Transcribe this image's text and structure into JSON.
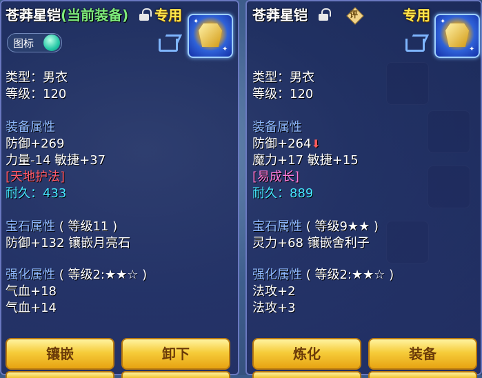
{
  "left": {
    "title": "苍莽星铠",
    "equipped_tag": "(当前装备)",
    "special_label": "专用",
    "icon_toggle_label": "图标",
    "type": "类型：男衣",
    "level": "等级：120",
    "section_equip": "装备属性",
    "attr1": "防御+269",
    "attr2": "力量-14 敏捷+37",
    "skill": "[天地护法]",
    "durability": "耐久：433",
    "gem_heading": "宝石属性",
    "gem_level": "( 等级11 )",
    "gem_attr": "防御+132 镶嵌月亮石",
    "enhance_heading": "强化属性",
    "enhance_level": "( 等级2:★★☆ )",
    "enhance1": "气血+18",
    "enhance2": "气血+14",
    "btn1": "镶嵌",
    "btn2": "卸下"
  },
  "right": {
    "title": "苍莽星铠",
    "special_label": "专用",
    "rate_label": "评",
    "type": "类型：男衣",
    "level": "等级：120",
    "section_equip": "装备属性",
    "attr1": "防御+264",
    "attr2": "魔力+17 敏捷+15",
    "skill": "[易成长]",
    "durability": "耐久：889",
    "gem_heading": "宝石属性",
    "gem_level": "( 等级9★★ )",
    "gem_attr": "灵力+68 镶嵌舍利子",
    "enhance_heading": "强化属性",
    "enhance_level": "( 等级2:★★☆ )",
    "enhance1": "法攻+2",
    "enhance2": "法攻+3",
    "btn1": "炼化",
    "btn2": "装备"
  },
  "icons": {
    "lock": "unlock-icon",
    "share": "share-icon",
    "down": "down-arrow-icon",
    "armor": "armor-icon",
    "rate": "rate-badge-icon"
  },
  "colors": {
    "heading": "#8fbaff",
    "durability": "#45e6ff",
    "skill_left": "#ff5a6a",
    "skill_right": "#ff7ad8",
    "special": "#ffe64a",
    "equipped": "#7dea7b"
  }
}
